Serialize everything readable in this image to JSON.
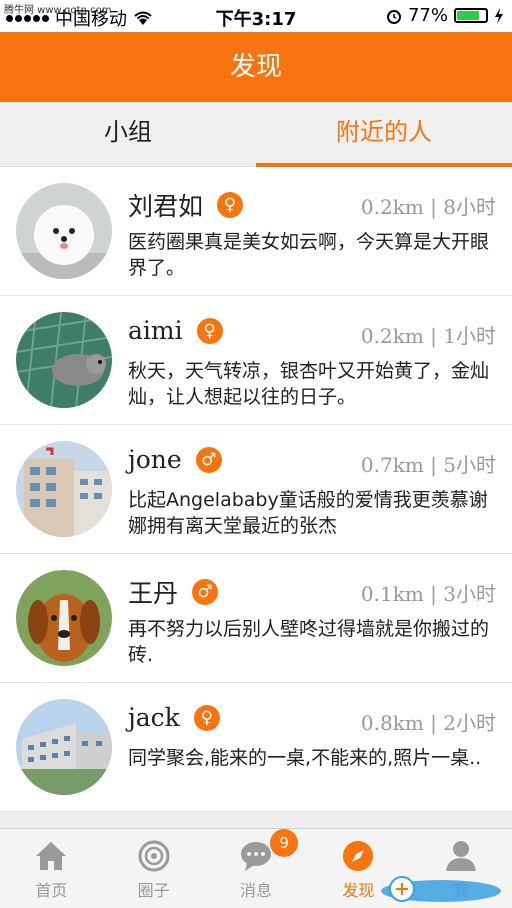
{
  "status_bar": {
    "watermark": "腾牛网 www.qqtn.com",
    "carrier": "中国移动",
    "time": "下午3:17",
    "battery": "77%",
    "battery_level": 0.77
  },
  "header": {
    "title": "发现"
  },
  "tabs": [
    {
      "label": "小组",
      "active": false
    },
    {
      "label": "附近的人",
      "active": true
    }
  ],
  "users": [
    {
      "name": "刘君如",
      "gender_icon": "female-icon",
      "distance": "0.2km",
      "time": "8小时",
      "message": "医药圈果真是美女如云啊，今天算是大开眼界了。"
    },
    {
      "name": "aimi",
      "gender_icon": "female-icon",
      "distance": "0.2km",
      "time": "1小时",
      "message": "秋天，天气转凉，银杏叶又开始黄了，金灿灿，让人想起以往的日子。"
    },
    {
      "name": "jone",
      "gender_icon": "male-icon",
      "distance": "0.7km",
      "time": "5小时",
      "message": "比起Angelababy童话般的爱情我更羡慕谢娜拥有离天堂最近的张杰"
    },
    {
      "name": "王丹",
      "gender_icon": "male-icon",
      "distance": "0.1km",
      "time": "3小时",
      "message": "再不努力以后别人壁咚过得墙就是你搬过的砖."
    },
    {
      "name": "jack",
      "gender_icon": "female-icon",
      "distance": "0.8km",
      "time": "2小时",
      "message": "同学聚会,能来的一桌,不能来的,照片一桌.."
    }
  ],
  "tabbar": [
    {
      "label": "首页",
      "icon": "home-icon"
    },
    {
      "label": "圈子",
      "icon": "circle-icon"
    },
    {
      "label": "消息",
      "icon": "message-icon",
      "badge": "9"
    },
    {
      "label": "发现",
      "icon": "compass-icon",
      "active": true
    },
    {
      "label": "我",
      "icon": "person-icon"
    }
  ],
  "colors": {
    "accent": "#f7740f",
    "divider": "#e2e2e2"
  }
}
